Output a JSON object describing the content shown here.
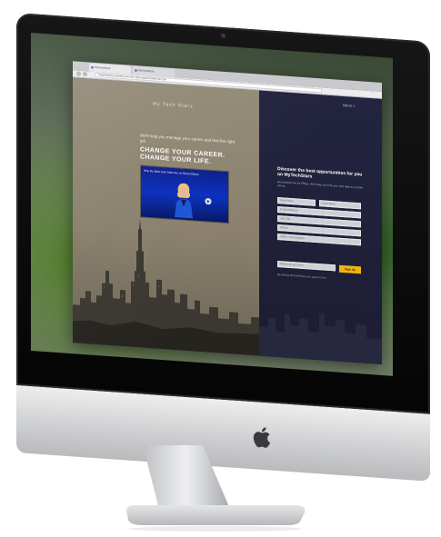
{
  "browser": {
    "tabs": [
      {
        "label": "MyTechStars"
      },
      {
        "label": "MyTechStars"
      }
    ],
    "url": "mytechstars.com/discover-the-best-opportunities-for-you"
  },
  "hero": {
    "brand": "My Tech Stars",
    "tagline": "We'll help you manage your career and find the right job.",
    "headline_line1": "CHANGE YOUR CAREER.",
    "headline_line2": "CHANGE YOUR LIFE.",
    "video_title": "Why the Best Tech Stars Are on MyTechStars"
  },
  "menu": {
    "label": "MENU ≡"
  },
  "signup": {
    "title": "Discover the best opportunities for you on MyTechStars",
    "subtitle": "Get started now for FREE. We'll help you find your next step to a better career.",
    "fields": {
      "first_name": "First Name",
      "last_name": "Last Name",
      "email": "Email Address",
      "job_title": "Job Title",
      "phone": "Phone",
      "skills": "Skills / Technologies",
      "location": "Where do you live?"
    },
    "submit_label": "Sign Up",
    "note": "By joining MyTechStars you agree to the"
  },
  "colors": {
    "accent": "#f1b413",
    "form_bg": "#232440",
    "hero_bg": "#938a77",
    "video_bg": "#0a2fbf"
  }
}
